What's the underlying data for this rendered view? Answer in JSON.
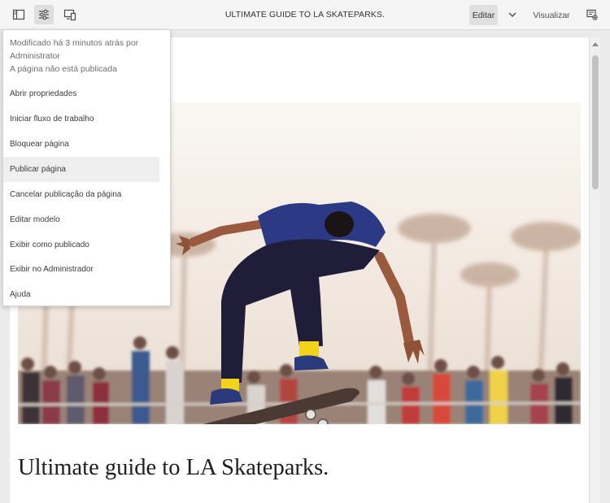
{
  "toolbar": {
    "icons": [
      "side-panel-icon",
      "page-settings-icon",
      "emulator-icon"
    ],
    "title": "ULTIMATE GUIDE TO LA SKATEPARKS.",
    "edit_label": "Editar",
    "preview_label": "Visualizar",
    "right_icon": "annotate-icon"
  },
  "menu": {
    "info": {
      "modified": "Modificado há 3 minutos atrás por",
      "user": "Administrator",
      "status": "A página não está publicada"
    },
    "items": [
      {
        "label": "Abrir propriedades"
      },
      {
        "label": "Iniciar fluxo de trabalho"
      },
      {
        "label": "Bloquear página"
      },
      {
        "label": "Publicar página"
      },
      {
        "label": "Cancelar publicação da página"
      },
      {
        "label": "Editar modelo"
      },
      {
        "label": "Exibir como publicado"
      },
      {
        "label": "Exibir no Administrador"
      },
      {
        "label": "Ajuda"
      }
    ],
    "hovered_index": 3
  },
  "page": {
    "heading": "Ultimate guide to LA Skateparks."
  },
  "colors": {
    "toolbar_bg": "#f5f5f5",
    "workspace_bg": "#eaeaea",
    "sky": "#f4ede6",
    "shirt": "#2c3a85",
    "pants": "#1f1d38",
    "socks": "#f2d21b",
    "board": "#4a3a33"
  }
}
